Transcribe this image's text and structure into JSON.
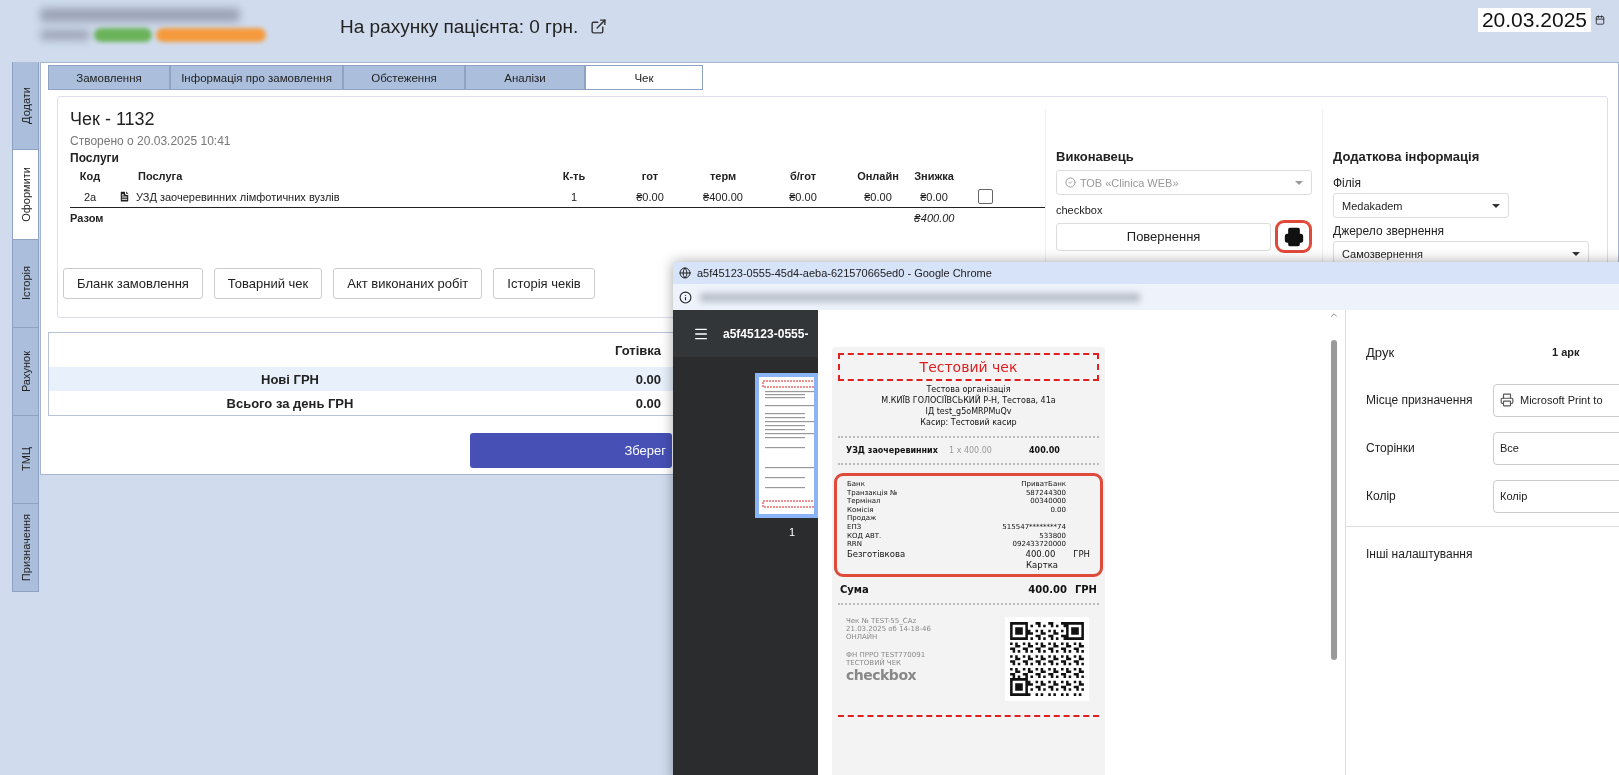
{
  "header": {
    "balance": "На рахунку пацієнта: 0 грн.",
    "date": "20.03.2025"
  },
  "side_tabs": [
    {
      "label": "Додати",
      "selected": false
    },
    {
      "label": "Оформити",
      "selected": true
    },
    {
      "label": "Історія",
      "selected": false
    },
    {
      "label": "Рахунок",
      "selected": false
    },
    {
      "label": "ТМЦ",
      "selected": false
    },
    {
      "label": "Призначення",
      "selected": false
    }
  ],
  "tabs": [
    {
      "label": "Замовлення",
      "selected": false
    },
    {
      "label": "Інформація про замовлення",
      "selected": false
    },
    {
      "label": "Обстеження",
      "selected": false
    },
    {
      "label": "Аналізи",
      "selected": false
    },
    {
      "label": "Чек",
      "selected": true
    }
  ],
  "check": {
    "title": "Чек - 1132",
    "created": "Створено о 20.03.2025 10:41",
    "section": "Послуги",
    "columns": [
      "Код",
      "Послуга",
      "К-ть",
      "гот",
      "терм",
      "б/гот",
      "Онлайн",
      "Знижка"
    ],
    "rows": [
      {
        "cells": [
          "2a",
          "УЗД заочеревинних лімфотичних вузлів",
          "1",
          "₴0.00",
          "₴400.00",
          "₴0.00",
          "₴0.00",
          "₴0.00"
        ],
        "checked": false
      }
    ],
    "total_label": "Разом",
    "total": "₴400.00",
    "actions": [
      "Бланк замовлення",
      "Товарний чек",
      "Акт виконаних робіт",
      "Історія чеків"
    ]
  },
  "performer": {
    "heading": "Виконавець",
    "select": "ТОВ «Clinica WEB»",
    "select_disabled": true,
    "provider": "checkbox",
    "return_button": "Повернення"
  },
  "additional": {
    "heading": "Додаткова інформація",
    "fields": [
      {
        "label": "Філія",
        "value": "Medakadem"
      },
      {
        "label": "Джерело звернення",
        "value": "Самозвернення"
      }
    ]
  },
  "cash_table": {
    "column": "Готівка",
    "rows": [
      {
        "label": "Нові ГРН",
        "value": "0.00"
      },
      {
        "label": "Всього за день ГРН",
        "value": "0.00"
      }
    ]
  },
  "save_button": "Зберег",
  "print_window": {
    "title": "a5f45123-0555-45d4-aeba-621570665ed0 - Google Chrome",
    "viewer_title": "a5f45123-0555-",
    "page_number": "1",
    "receipt": {
      "banner": "Тестовий чек",
      "header_lines": [
        "Тестова організація",
        "М.КИЇВ ГОЛОСІЇВСЬКИЙ Р-Н, Тестова, 41а",
        "ІД test_g5oMRPMuQv",
        "Касир: Тестовий касир"
      ],
      "item": {
        "name": "УЗД заочеревинних",
        "qty": "1 x 400.00",
        "sum": "400.00"
      },
      "details": [
        {
          "label": "Банк",
          "value": "ПриватБанк"
        },
        {
          "label": "Транзакція №",
          "value": "587244300"
        },
        {
          "label": "Термінал",
          "value": "00340000"
        },
        {
          "label": "Комісія",
          "value": "0.00"
        },
        {
          "label": "Продаж"
        },
        {
          "label": "ЕПЗ",
          "value": "515547********74"
        },
        {
          "label": "КОД АВТ.",
          "value": "533800"
        },
        {
          "label": "RRN",
          "value": "092433720000"
        }
      ],
      "payment": {
        "label": "Безготівкова",
        "amount": "400.00",
        "currency": "ГРН",
        "method": "Картка"
      },
      "total": {
        "label": "Сума",
        "amount": "400.00",
        "currency": "ГРН"
      },
      "footer_lines": [
        "Чек № TEST-55_CAz",
        "21.03.2025 об 14-18-46",
        "ОНЛАЙН"
      ],
      "fiscal_lines": [
        "ФН ПРРО TEST770091",
        "ТЕСТОВИЙ ЧЕК"
      ],
      "brand": "checkbox"
    },
    "settings": {
      "heading": "Друк",
      "sheets": "1 арк",
      "fields": [
        {
          "label": "Місце призначення",
          "value": "Microsoft Print to",
          "kind": "printer"
        },
        {
          "label": "Сторінки",
          "value": "Все",
          "kind": "plain"
        },
        {
          "label": "Колір",
          "value": "Колір",
          "kind": "plain"
        }
      ],
      "more": "Інші налаштування"
    }
  }
}
